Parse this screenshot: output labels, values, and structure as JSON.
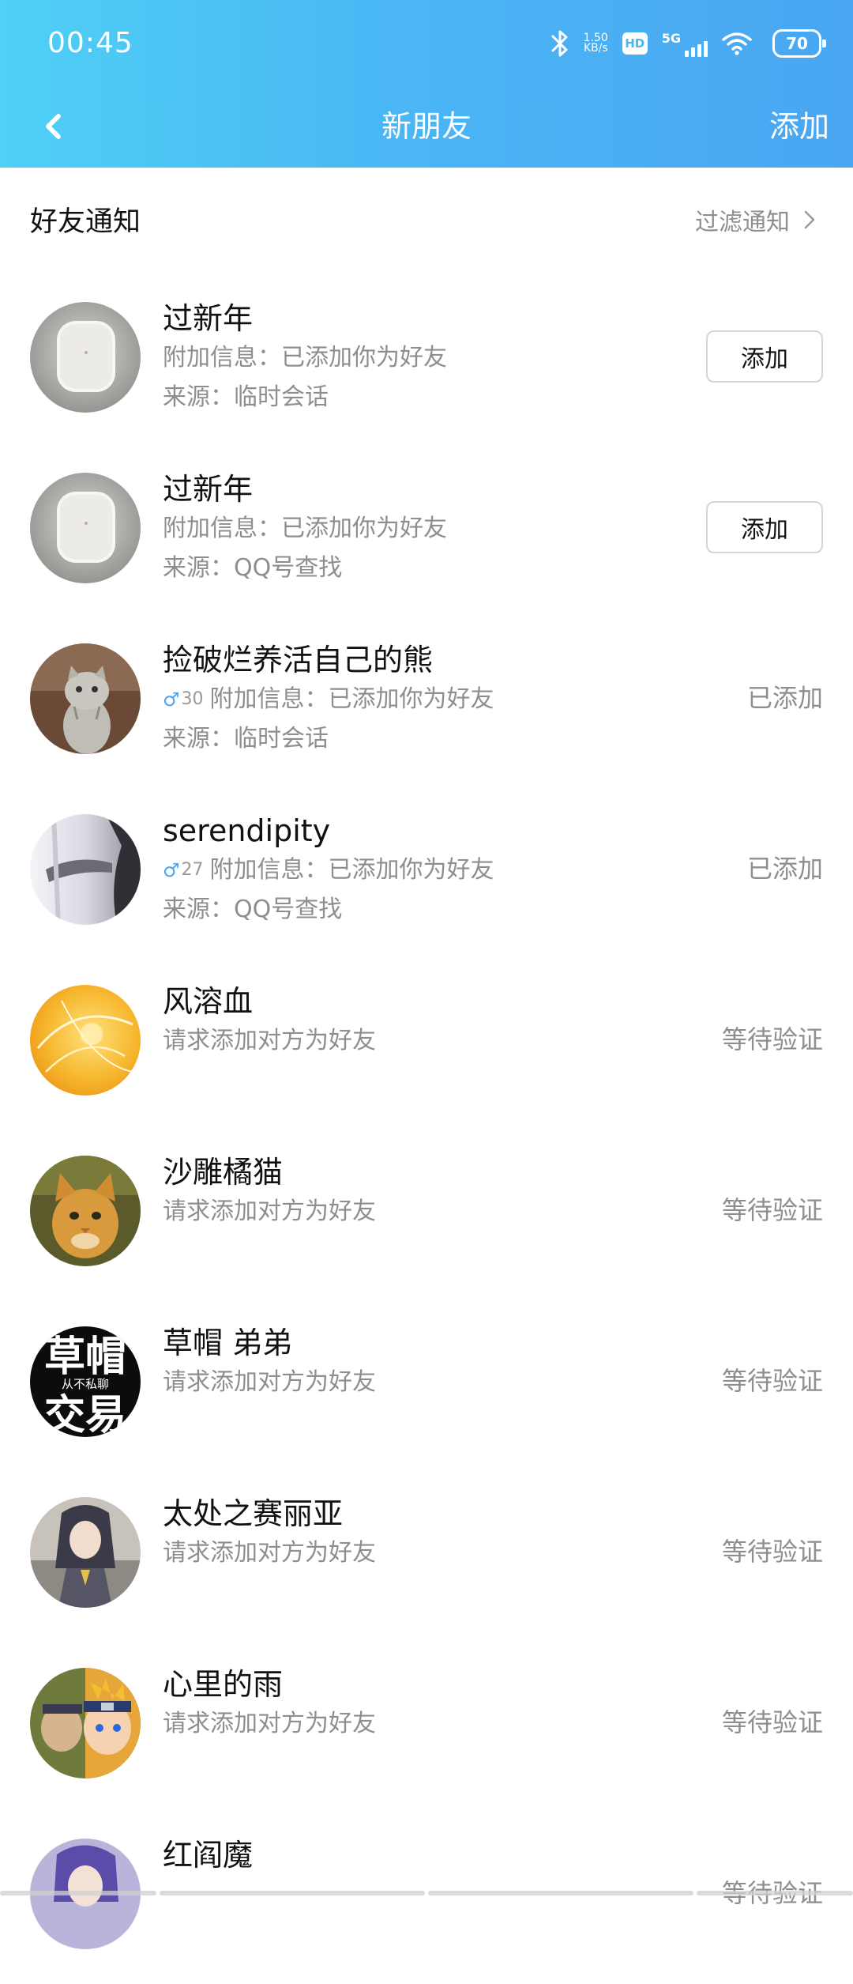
{
  "status_bar": {
    "time": "00:45",
    "net_speed_value": "1.50",
    "net_speed_unit": "KB/s",
    "hd_label": "HD",
    "signal_label": "5G",
    "battery": "70"
  },
  "header": {
    "title": "新朋友",
    "add_label": "添加"
  },
  "section": {
    "title": "好友通知",
    "filter_label": "过滤通知"
  },
  "colors": {
    "header_gradient_start": "#4fd0f5",
    "header_gradient_end": "#4aa6f2",
    "secondary_text": "#8e8e8e",
    "gender_male": "#4aa6f2"
  },
  "requests": [
    {
      "name": "过新年",
      "line1": "附加信息：已添加你为好友",
      "line2": "来源：临时会话",
      "action": "添加",
      "avatar_icon": "earbuds-case-avatar"
    },
    {
      "name": "过新年",
      "line1": "附加信息：已添加你为好友",
      "line2": "来源：QQ号查找",
      "action": "添加",
      "avatar_icon": "earbuds-case-avatar"
    },
    {
      "name": "捡破烂养活自己的熊",
      "age": "30",
      "line1": "附加信息：已添加你为好友",
      "line2": "来源：临时会话",
      "action": "已添加",
      "avatar_icon": "cat-photo-avatar"
    },
    {
      "name": "serendipity",
      "age": "27",
      "line1": "附加信息：已添加你为好友",
      "line2": "来源：QQ号查找",
      "action": "已添加",
      "avatar_icon": "bw-photo-avatar"
    },
    {
      "name": "风溶血",
      "line1": "请求添加对方为好友",
      "action": "等待验证",
      "avatar_icon": "orange-abstract-avatar"
    },
    {
      "name": "沙雕橘猫",
      "line1": "请求添加对方为好友",
      "action": "等待验证",
      "avatar_icon": "orange-cat-avatar"
    },
    {
      "name": "草帽 弟弟",
      "line1": "请求添加对方为好友",
      "action": "等待验证",
      "avatar_icon": "calligraphy-avatar",
      "avatar_text": [
        "草帽",
        "从不私聊",
        "交易"
      ]
    },
    {
      "name": "太处之赛丽亚",
      "line1": "请求添加对方为好友",
      "action": "等待验证",
      "avatar_icon": "anime-girl-avatar"
    },
    {
      "name": "心里的雨",
      "line1": "请求添加对方为好友",
      "action": "等待验证",
      "avatar_icon": "ninja-anime-avatar"
    },
    {
      "name": "红阎魔",
      "action": "等待验证",
      "avatar_icon": "purple-anime-avatar"
    }
  ]
}
